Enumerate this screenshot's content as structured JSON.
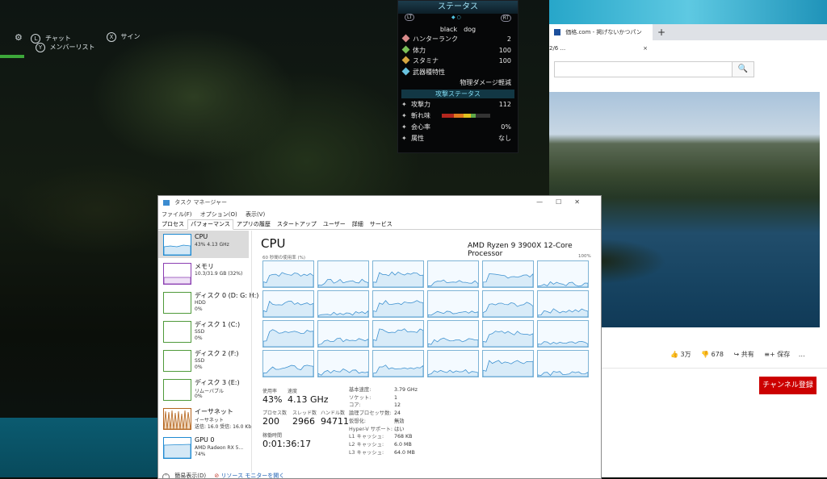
{
  "game": {
    "hud": {
      "chat": "チャット",
      "sign": "サイン",
      "member_list": "メンバーリスト",
      "btn_x": "X",
      "btn_y": "Y"
    },
    "status": {
      "title": "ステータス",
      "lt": "LT",
      "rt": "RT",
      "player": "black　dog",
      "rows": [
        {
          "label": "ハンターランク",
          "value": "2",
          "color": "#d98b8b"
        },
        {
          "label": "体力",
          "value": "100",
          "color": "#7bbf58"
        },
        {
          "label": "スタミナ",
          "value": "100",
          "color": "#d6a640"
        },
        {
          "label": "武器種特性",
          "value": "",
          "color": "#6ac3e0"
        }
      ],
      "weapon_trait": "物理ダメージ軽減",
      "attack_header": "攻撃ステータス",
      "attack_rows": [
        {
          "label": "攻撃力",
          "value": "112"
        },
        {
          "label": "斬れ味",
          "value": ""
        },
        {
          "label": "会心率",
          "value": "0%"
        },
        {
          "label": "属性",
          "value": "なし"
        }
      ]
    }
  },
  "browser": {
    "tab_title": "価格.com - 掲げないかつパン 2/6 ...",
    "tab_close": "×",
    "new_tab": "+",
    "search_icon": "🔍",
    "likes": "3万",
    "dislikes": "678",
    "share": "共有",
    "save": "保存",
    "more": "…",
    "subscribe": "チャンネル登録"
  },
  "taskmgr": {
    "title": "タスク マネージャー",
    "window_controls": [
      "—",
      "☐",
      "✕"
    ],
    "menu": [
      "ファイル(F)",
      "オプション(O)",
      "表示(V)"
    ],
    "tabs": [
      "プロセス",
      "パフォーマンス",
      "アプリの履歴",
      "スタートアップ",
      "ユーザー",
      "詳細",
      "サービス"
    ],
    "active_tab": 1,
    "sidebar": [
      {
        "name": "CPU",
        "d1": "43%  4.13 GHz",
        "d2": "",
        "color": "#1f8ad2"
      },
      {
        "name": "メモリ",
        "d1": "10.3/31.9 GB (32%)",
        "d2": "",
        "color": "#8b3fb2"
      },
      {
        "name": "ディスク 0 (D: G: H:)",
        "d1": "HDD",
        "d2": "0%",
        "color": "#4f9a3a"
      },
      {
        "name": "ディスク 1 (C:)",
        "d1": "SSD",
        "d2": "0%",
        "color": "#4f9a3a"
      },
      {
        "name": "ディスク 2 (F:)",
        "d1": "SSD",
        "d2": "0%",
        "color": "#4f9a3a"
      },
      {
        "name": "ディスク 3 (E:)",
        "d1": "リムーバブル",
        "d2": "0%",
        "color": "#4f9a3a"
      },
      {
        "name": "イーサネット",
        "d1": "イーサネット",
        "d2": "送信: 16.0  受信: 16.0 Kb",
        "color": "#b5651d"
      },
      {
        "name": "GPU 0",
        "d1": "AMD Radeon RX 5...",
        "d2": "74%",
        "color": "#1f8ad2"
      }
    ],
    "panel_title": "CPU",
    "processor": "AMD Ryzen 9 3900X 12-Core Processor",
    "graph_label": "60 秒間の使用率 (%)",
    "graph_max": "100%",
    "stats": {
      "usage_label": "使用率",
      "usage": "43%",
      "speed_label": "速度",
      "speed": "4.13 GHz",
      "proc_label": "プロセス数",
      "proc": "200",
      "thread_label": "スレッド数",
      "thread": "2966",
      "handle_label": "ハンドル数",
      "handle": "94711",
      "uptime_label": "稼働時間",
      "uptime": "0:01:36:17"
    },
    "specs": [
      {
        "k": "基本速度:",
        "v": "3.79 GHz"
      },
      {
        "k": "ソケット:",
        "v": "1"
      },
      {
        "k": "コア:",
        "v": "12"
      },
      {
        "k": "論理プロセッサ数:",
        "v": "24"
      },
      {
        "k": "仮想化:",
        "v": "無効"
      },
      {
        "k": "Hyper-V サポート:",
        "v": "はい"
      },
      {
        "k": "L1 キャッシュ:",
        "v": "768 KB"
      },
      {
        "k": "L2 キャッシュ:",
        "v": "6.0 MB"
      },
      {
        "k": "L3 キャッシュ:",
        "v": "64.0 MB"
      }
    ],
    "bottom_simple": "簡易表示(D)",
    "bottom_monitor": "リソース モニターを開く"
  }
}
